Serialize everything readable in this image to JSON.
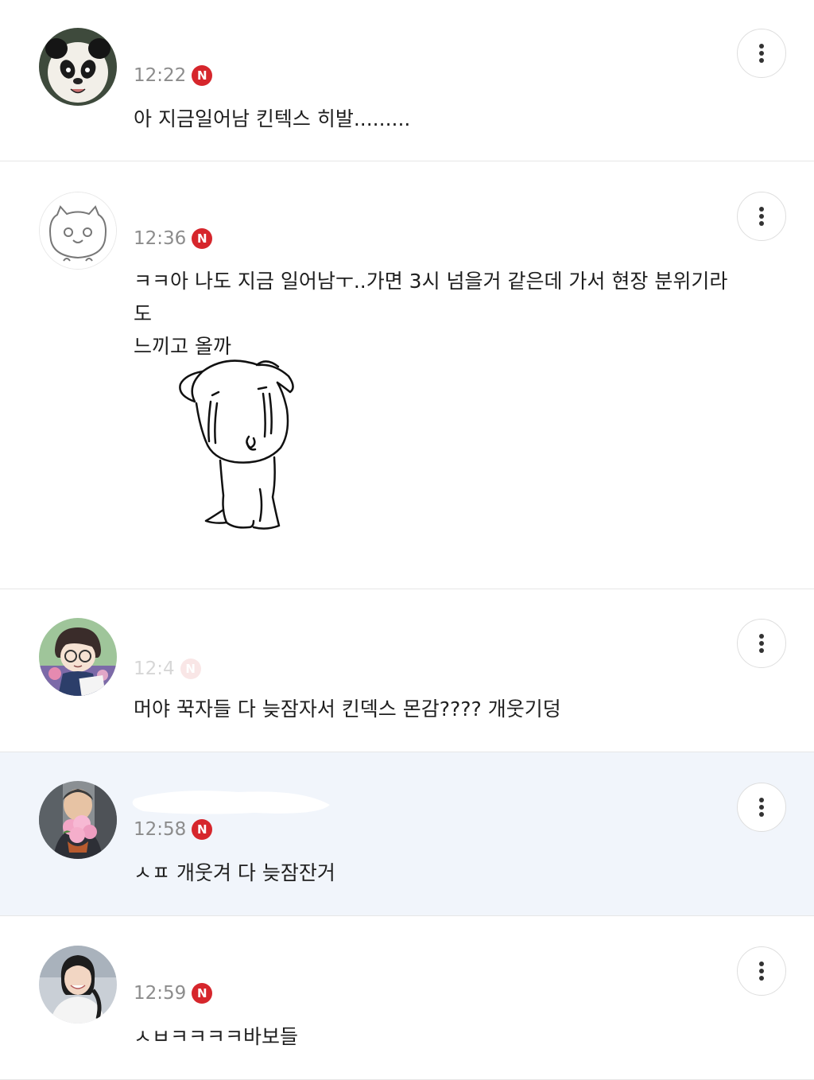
{
  "comments": [
    {
      "time": "12:22",
      "badge": "N",
      "text": "아 지금일어남 킨텍스 히발.........",
      "avatar": "panda-avatar"
    },
    {
      "time": "12:36",
      "badge": "N",
      "text": "ㅋㅋ아 나도 지금 일어남ㅜ..가면 3시 넘을거 같은데 가서 현장 분위기라도\n느끼고 올까",
      "avatar": "cat-drawing-avatar",
      "sticker": "crying-puppy-sticker"
    },
    {
      "time": "12:4",
      "badge": "N",
      "text": "머야 꾹자들 다 늦잠자서 킨덱스 몬감???? 개웃기덩",
      "avatar": "glasses-character-avatar"
    },
    {
      "time": "12:58",
      "badge": "N",
      "text": "ㅅㅍ 개웃겨 다 늦잠잔거",
      "avatar": "flower-person-avatar"
    },
    {
      "time": "12:59",
      "badge": "N",
      "text": "ㅅㅂㅋㅋㅋㅋ바보들",
      "avatar": "smiling-woman-avatar"
    }
  ],
  "icons": {
    "more": "more-vertical-icon",
    "new_badge": "new-badge-icon"
  },
  "colors": {
    "badge": "#d6262c",
    "highlight_row": "#f1f5fb",
    "time_text": "#8c8c8c",
    "divider": "#e6e6e6"
  }
}
